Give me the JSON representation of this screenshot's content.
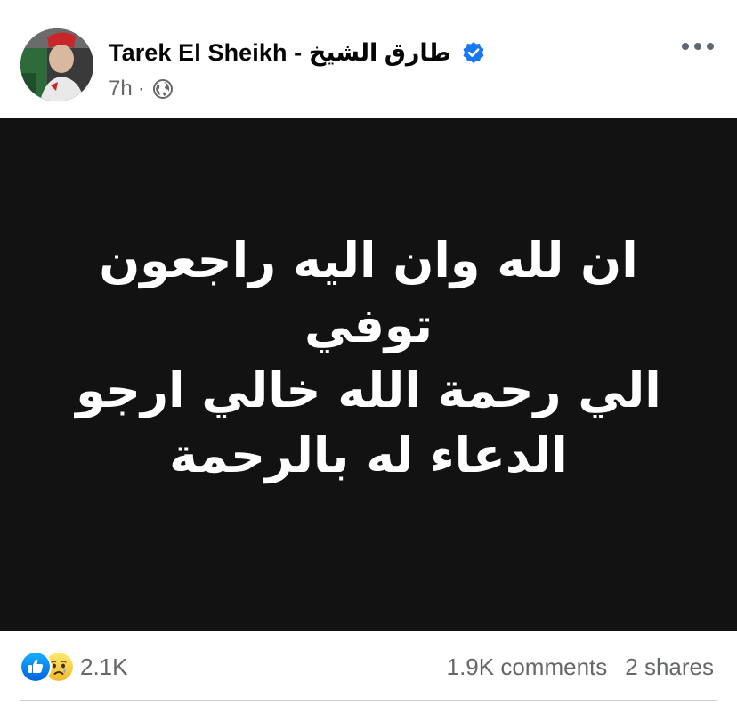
{
  "author": {
    "name": "Tarek El Sheikh - طارق الشيخ",
    "verified": true,
    "avatar_icon": "profile-photo"
  },
  "meta": {
    "time": "7h",
    "separator": "·",
    "audience_icon": "globe-icon"
  },
  "post": {
    "image_text": "ان لله وان اليه راجعون توفي\nالي رحمة الله  خالي ارجو\nالدعاء له بالرحمة",
    "background_color": "#121212"
  },
  "footer": {
    "reaction_icons": [
      "like-icon",
      "sad-icon"
    ],
    "reaction_count": "2.1K",
    "comments": "1.9K comments",
    "shares": "2 shares"
  },
  "colors": {
    "accent": "#1877f2",
    "secondary_text": "#65676b"
  }
}
